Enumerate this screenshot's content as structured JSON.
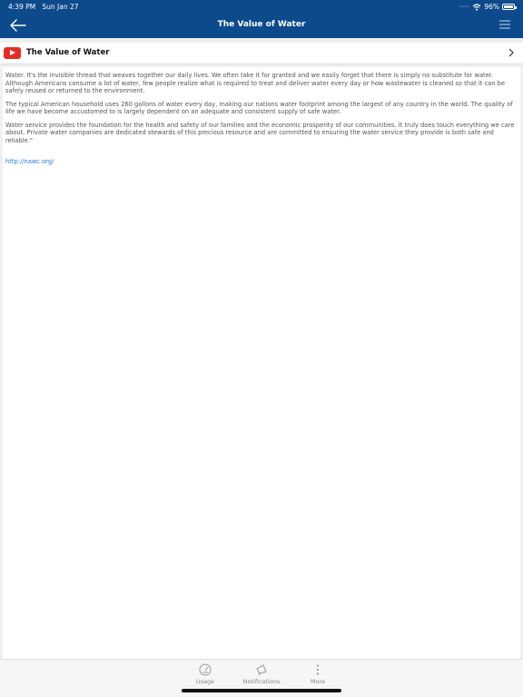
{
  "status_bar": {
    "time": "4:39 PM",
    "date": "Sun Jan 27",
    "battery": "96%",
    "battery_level": 0.96
  },
  "header": {
    "title": "The Value of Water"
  },
  "video_row": {
    "title": "The Value of Water"
  },
  "article": {
    "paragraphs": [
      "Water. It's the invisible thread that weaves together our daily lives. We often take it for granted and we easily forget that there is simply no substitute for water. Although Americans consume a lot of water, few people realize what is required to treat and deliver water every day or how wastewater is cleaned so that it can be safely reused or returned to the environment.",
      "The typical American household uses 260 gallons of water every day, making our nations water footprint among the largest of any country in the world. The quality of life we have become accustomed to is largely dependent on an adequate and consistent supply of safe water.",
      "Water service provides the foundation for the health and safety of our families and the economic prosperity of our communities. It truly does touch everything we care about. Private water companies are dedicated stewards of this precious resource and are committed to ensuring the water service they provide is both safe and reliable.\""
    ],
    "link": "http://nawc.org/"
  },
  "tabs": [
    {
      "label": "Usage",
      "icon": "gauge-icon"
    },
    {
      "label": "Notifications",
      "icon": "megaphone-icon"
    },
    {
      "label": "More",
      "icon": "more-vertical-icon"
    }
  ]
}
